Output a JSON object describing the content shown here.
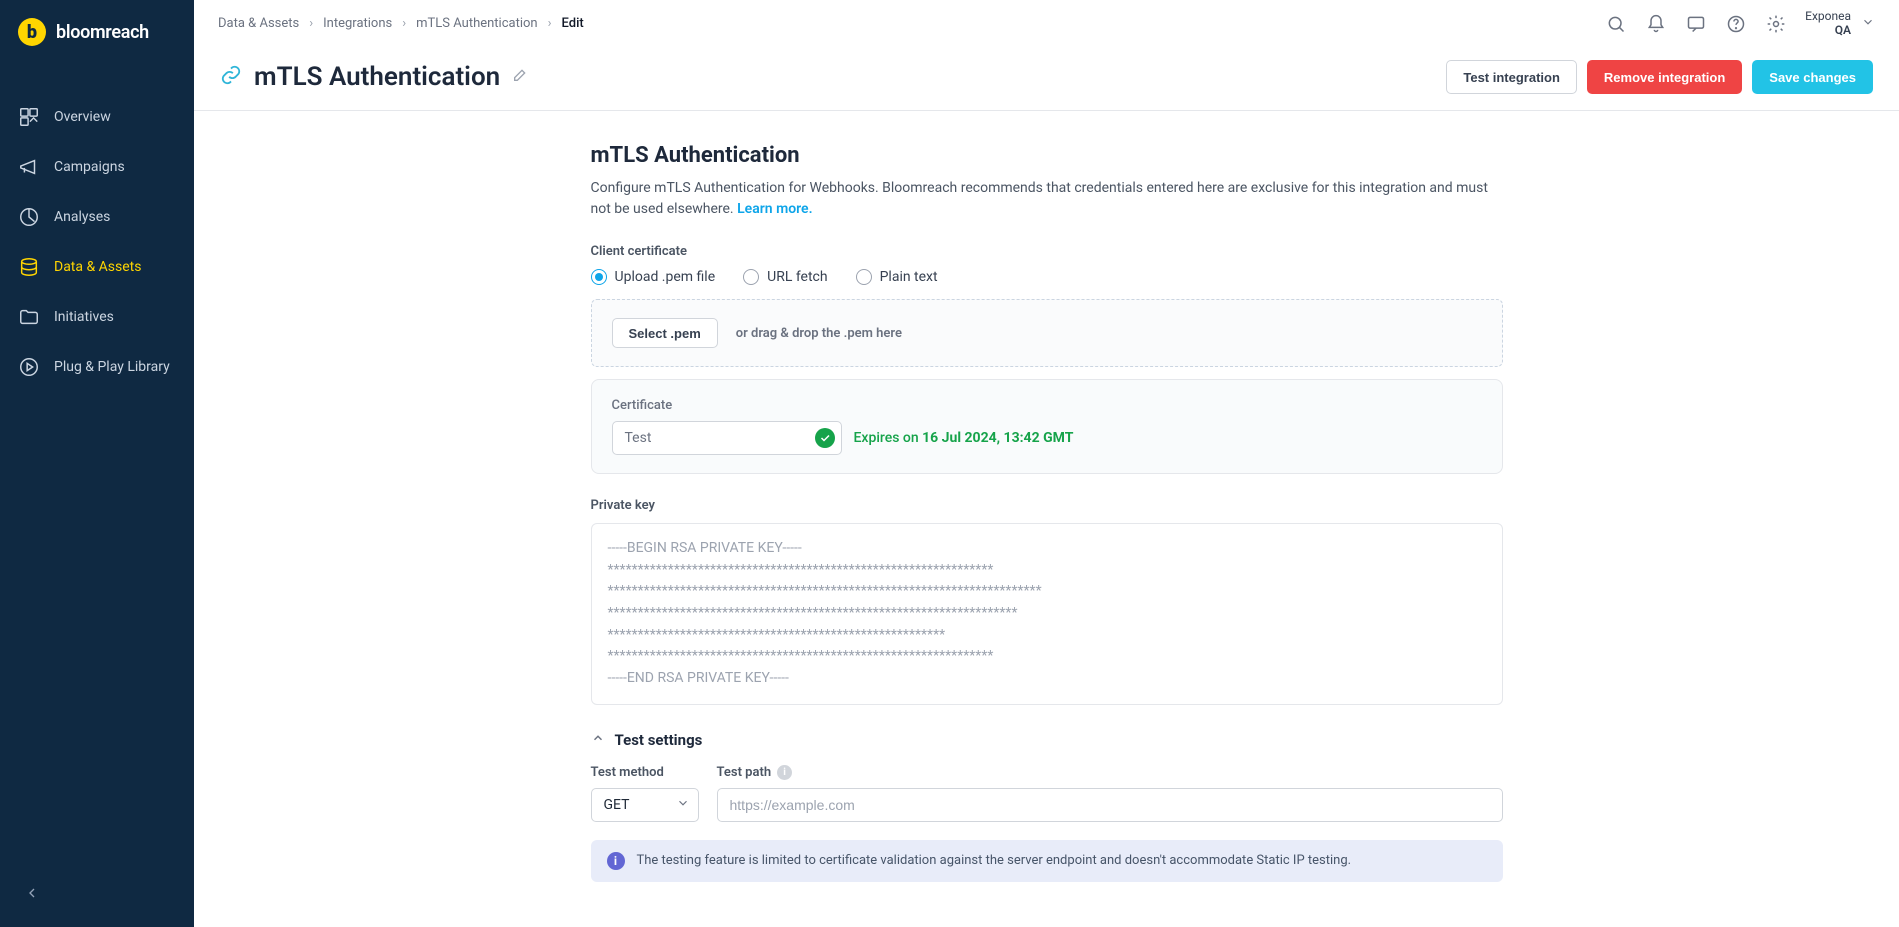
{
  "brand": {
    "name": "bloomreach",
    "badge_letter": "b"
  },
  "sidebar": {
    "items": [
      {
        "label": "Overview"
      },
      {
        "label": "Campaigns"
      },
      {
        "label": "Analyses"
      },
      {
        "label": "Data & Assets"
      },
      {
        "label": "Initiatives"
      },
      {
        "label": "Plug & Play Library"
      }
    ]
  },
  "breadcrumbs": {
    "items": [
      "Data & Assets",
      "Integrations",
      "mTLS Authentication"
    ],
    "current": "Edit"
  },
  "account": {
    "line1": "Exponea",
    "line2": "QA"
  },
  "header": {
    "title": "mTLS Authentication",
    "actions": {
      "test": "Test integration",
      "remove": "Remove integration",
      "save": "Save changes"
    }
  },
  "section": {
    "title": "mTLS Authentication",
    "desc": "Configure mTLS Authentication for Webhooks. Bloomreach recommends that credentials entered here are exclusive for this integration and must not be used elsewhere. ",
    "learn_more": "Learn more."
  },
  "client_cert": {
    "label": "Client certificate",
    "options": {
      "upload": "Upload .pem file",
      "url": "URL fetch",
      "plain": "Plain text"
    },
    "select_btn": "Select .pem",
    "drop_text": "or drag & drop the .pem here"
  },
  "certificate": {
    "label": "Certificate",
    "name": "Test",
    "expires_prefix": "Expires on ",
    "expires_date": "16 Jul 2024, 13:42 GMT"
  },
  "private_key": {
    "label": "Private key",
    "value": "-----BEGIN RSA PRIVATE KEY-----\n****************************************************************\n************************************************************************\n********************************************************************\n********************************************************\n****************************************************************\n-----END RSA PRIVATE KEY-----"
  },
  "test_settings": {
    "title": "Test settings",
    "method_label": "Test method",
    "method_value": "GET",
    "path_label": "Test path",
    "path_placeholder": "https://example.com",
    "notice": "The testing feature is limited to certificate validation against the server endpoint and doesn't accommodate Static IP testing."
  }
}
